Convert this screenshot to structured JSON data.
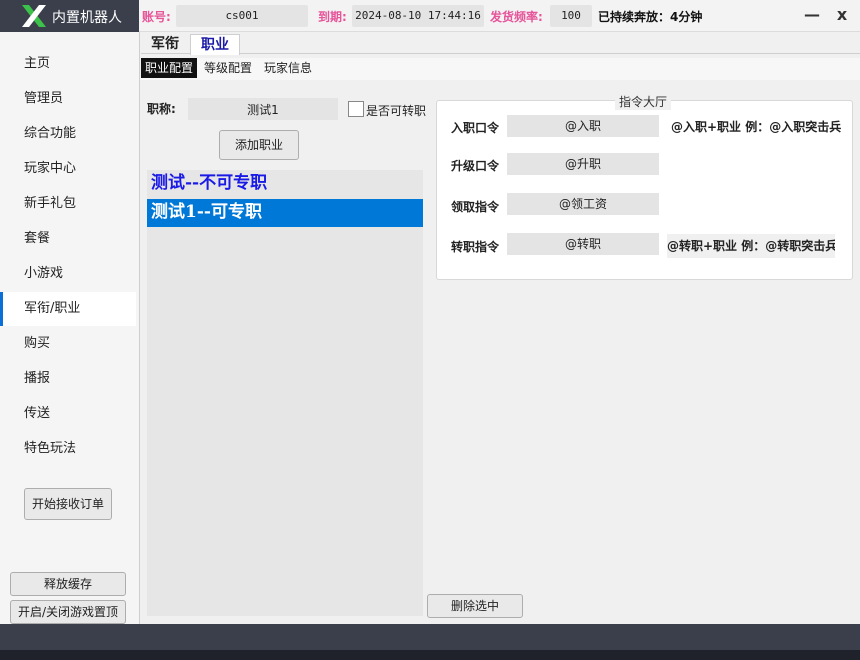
{
  "app": {
    "title": "内置机器人"
  },
  "header": {
    "account_label": "账号:",
    "account_value": "cs001",
    "expire_label": "到期:",
    "expire_value": "2024-08-10 17:44:16",
    "freq_label": "发货频率:",
    "freq_value": "100",
    "status": "已持续奔放：4分钟",
    "minimize": "—",
    "close": "x"
  },
  "sidebar": {
    "items": [
      {
        "label": "主页"
      },
      {
        "label": "管理员"
      },
      {
        "label": "综合功能"
      },
      {
        "label": "玩家中心"
      },
      {
        "label": "新手礼包"
      },
      {
        "label": "套餐"
      },
      {
        "label": "小游戏"
      },
      {
        "label": "军衔/职业"
      },
      {
        "label": "购买"
      },
      {
        "label": "播报"
      },
      {
        "label": "传送"
      },
      {
        "label": "特色玩法"
      }
    ],
    "start_orders": "开始接收订单",
    "release_cache": "释放缓存",
    "toggle_top": "开启/关闭游戏置顶"
  },
  "tabs": [
    {
      "label": "军衔"
    },
    {
      "label": "职业"
    }
  ],
  "subtabs": [
    {
      "label": "职业配置"
    },
    {
      "label": "等级配置"
    },
    {
      "label": "玩家信息"
    }
  ],
  "job_form": {
    "label": "职称:",
    "value": "测试1",
    "transfer_label": "是否可转职",
    "add_button": "添加职业"
  },
  "job_list": [
    {
      "text": "测试--不可专职"
    },
    {
      "text": "测试1--可专职"
    }
  ],
  "command_hall": {
    "title": "指令大厅",
    "rows": [
      {
        "label": "入职口令",
        "value": "@入职",
        "hint": "@入职+职业 例：@入职突击兵"
      },
      {
        "label": "升级口令",
        "value": "@升职",
        "hint": ""
      },
      {
        "label": "领取指令",
        "value": "@领工资",
        "hint": ""
      },
      {
        "label": "转职指令",
        "value": "@转职",
        "hint": "@转职+职业 例：@转职突击兵"
      }
    ]
  },
  "delete_button": "删除选中",
  "colors": {
    "accent": "#0078d7",
    "header_label": "#e6549a",
    "dark": "#3a3f4b",
    "job_text": "#1a1ae6"
  }
}
